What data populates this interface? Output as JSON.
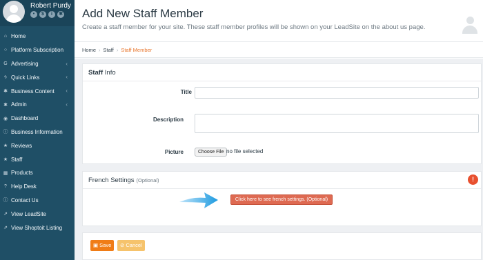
{
  "user": {
    "name": "Robert Purdy"
  },
  "sidebar": {
    "items": [
      {
        "label": "Home",
        "icon": "home-icon",
        "glyph": "⌂",
        "chevron": false
      },
      {
        "label": "Platform Subscription",
        "icon": "circle-icon",
        "glyph": "○",
        "chevron": false
      },
      {
        "label": "Advertising",
        "icon": "google-icon",
        "glyph": "G",
        "chevron": true
      },
      {
        "label": "Quick Links",
        "icon": "bolt-icon",
        "glyph": "ϟ",
        "chevron": true
      },
      {
        "label": "Business Content",
        "icon": "gear-icon",
        "glyph": "✱",
        "chevron": true
      },
      {
        "label": "Admin",
        "icon": "gear-icon",
        "glyph": "✱",
        "chevron": true
      },
      {
        "label": "Dashboard",
        "icon": "dashboard-icon",
        "glyph": "◉",
        "chevron": false
      },
      {
        "label": "Business Information",
        "icon": "info-icon",
        "glyph": "ⓘ",
        "chevron": false
      },
      {
        "label": "Reviews",
        "icon": "star-icon",
        "glyph": "★",
        "chevron": false
      },
      {
        "label": "Staff",
        "icon": "star-icon",
        "glyph": "★",
        "chevron": false
      },
      {
        "label": "Products",
        "icon": "cart-icon",
        "glyph": "▦",
        "chevron": false
      },
      {
        "label": "Help Desk",
        "icon": "question-icon",
        "glyph": "?",
        "chevron": false
      },
      {
        "label": "Contact Us",
        "icon": "info-icon",
        "glyph": "ⓘ",
        "chevron": false
      },
      {
        "label": "View LeadSite",
        "icon": "link-icon",
        "glyph": "⇗",
        "chevron": false
      },
      {
        "label": "View Shoptoit Listing",
        "icon": "link-icon",
        "glyph": "⇗",
        "chevron": false
      }
    ]
  },
  "header": {
    "title": "Add New Staff Member",
    "subtitle": "Create a staff member for your site. These staff member profiles will be shown on your LeadSite on the about us page."
  },
  "breadcrumb": {
    "home": "Home",
    "staff": "Staff",
    "current": "Staff Member"
  },
  "staff_panel": {
    "title_bold": "Staff",
    "title_rest": "Info",
    "title_label": "Title",
    "title_value": "",
    "description_label": "Description",
    "description_value": "",
    "picture_label": "Picture",
    "choose_file": "Choose File",
    "no_file": "no file selected"
  },
  "french_panel": {
    "title": "French Settings",
    "optional": "(Optional)",
    "button": "Click here to see french settings. (Optional)",
    "alert": "!"
  },
  "actions": {
    "save": "Save",
    "cancel": "Cancel"
  },
  "colors": {
    "sidebar": "#1f4f66",
    "accent_orange": "#f07c16",
    "french_button": "#de6a52",
    "arrow_blue": "#1e9be0"
  }
}
